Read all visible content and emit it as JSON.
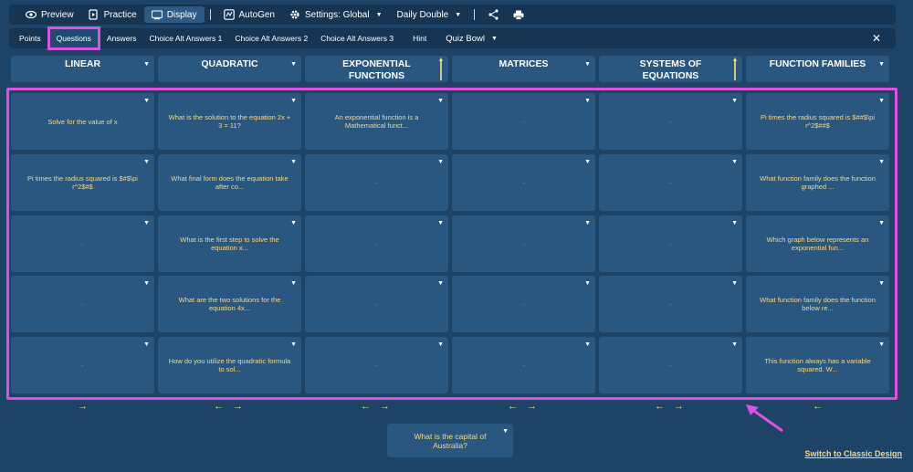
{
  "toolbar": {
    "preview": "Preview",
    "practice": "Practice",
    "display": "Display",
    "autogen": "AutoGen",
    "settings": "Settings: Global",
    "daily_double": "Daily Double"
  },
  "subbar": {
    "points": "Points",
    "questions": "Questions",
    "answers": "Answers",
    "alt1": "Choice Alt Answers 1",
    "alt2": "Choice Alt Answers 2",
    "alt3": "Choice Alt Answers 3",
    "hint": "Hint",
    "quiz_bowl": "Quiz Bowl",
    "close": "✕"
  },
  "columns": [
    {
      "title": "LINEAR"
    },
    {
      "title": "QUADRATIC"
    },
    {
      "title": "EXPONENTIAL FUNCTIONS"
    },
    {
      "title": "MATRICES"
    },
    {
      "title": "SYSTEMS OF EQUATIONS"
    },
    {
      "title": "FUNCTION FAMILIES"
    }
  ],
  "cells": [
    [
      "Solve for the value of x",
      "Pi times the radius squared is $#$\\pi r^2$#$",
      "-",
      "-",
      "-"
    ],
    [
      "What is the solution to the equation 2x + 3 = 11?",
      "What final form does the equation take after co...",
      "What is the first step to solve the equation x...",
      "What are the two solutions for the equation 4x...",
      "How do you utilize the quadratic formula to sol..."
    ],
    [
      "An exponential function is a Mathematical funct...",
      "-",
      "-",
      "-",
      "-"
    ],
    [
      "-",
      "-",
      "-",
      "-",
      "-"
    ],
    [
      "-",
      "-",
      "-",
      "-",
      "-"
    ],
    [
      "Pi times the radius squared is $##$\\pi r^2$##$",
      "What function family does the function graphed ...",
      "Which graph below represents an exponential fun...",
      "What function family does the function below re...",
      "This function always has a variable squared. W..."
    ]
  ],
  "bottom_card": "What is the capital of Australia?",
  "switch_link": "Switch to Classic Design",
  "colors": {
    "background": "#1d4466",
    "card": "#2a5780",
    "accent_text": "#f2d98a",
    "highlight": "#e04fe0"
  }
}
